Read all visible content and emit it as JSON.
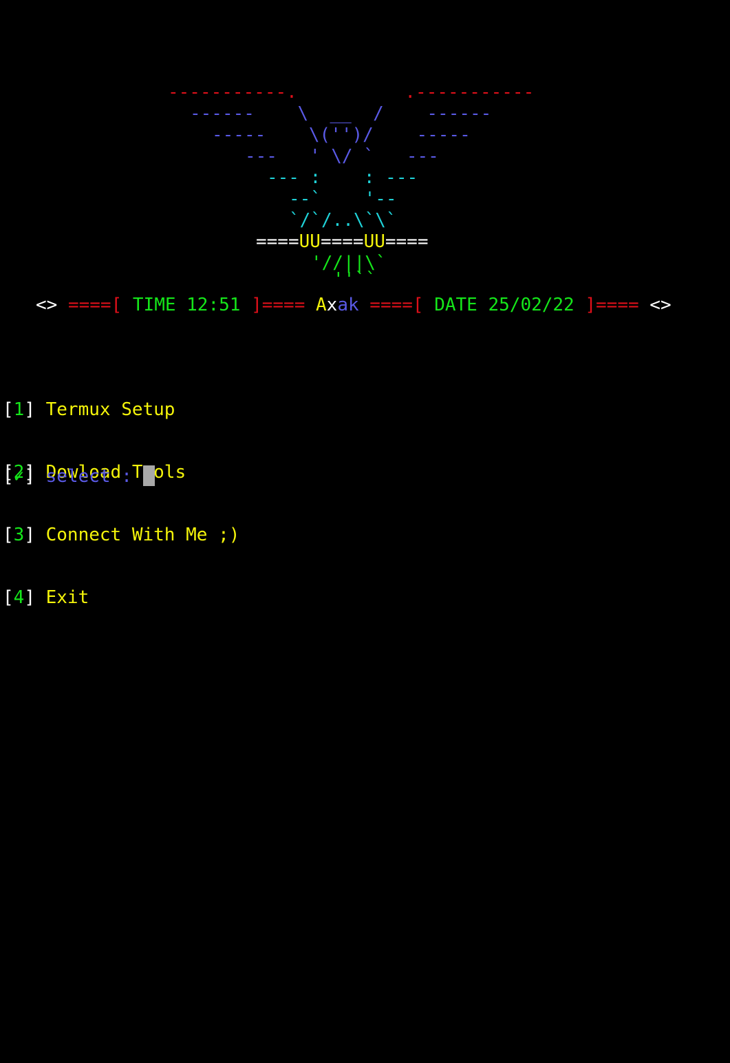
{
  "art": {
    "wing_top_left": "-----------.",
    "wing_top_right": ".-----------",
    "row2_left": "------",
    "row2_mid": "\\  __  /",
    "row2_right": "------",
    "row3_left": "-----",
    "row3_mid": "\\('')/",
    "row3_right": "-----",
    "row4_left": "---",
    "row4_mid": "' \\/ `",
    "row4_right": "---",
    "row5": "--- :    : ---",
    "row6": "--`    '--",
    "row7": "`/`/..\\`\\`",
    "row8_a": "====",
    "row8_b": "UU",
    "row8_c": "====",
    "row8_d": "UU",
    "row8_e": "====",
    "row9": "'//||\\`",
    "row10": "''``"
  },
  "status": {
    "left_marker": "<>",
    "time_open": "====[ ",
    "time_text": "TIME 12:51",
    "time_close": " ]====",
    "name_a": "A",
    "name_x": "x",
    "name_ak": "ak",
    "date_open": "====[ ",
    "date_text": "DATE 25/02/22",
    "date_close": " ]====",
    "right_marker": "<>"
  },
  "menu": {
    "items": [
      {
        "num": "1",
        "label": "Termux Setup"
      },
      {
        "num": "2",
        "label": "Dowload Tools"
      },
      {
        "num": "3",
        "label": "Connect With Me ;)"
      },
      {
        "num": "4",
        "label": "Exit"
      }
    ]
  },
  "prompt": {
    "mark": "✓",
    "label": "select : "
  },
  "colors": {
    "background": "#000000",
    "red": "#e0101a",
    "blue": "#5a5ae6",
    "cyan": "#1fd2d8",
    "yellow": "#f4f40a",
    "green": "#15e61a",
    "white": "#ffffff",
    "cursor": "#a8a8a8"
  }
}
